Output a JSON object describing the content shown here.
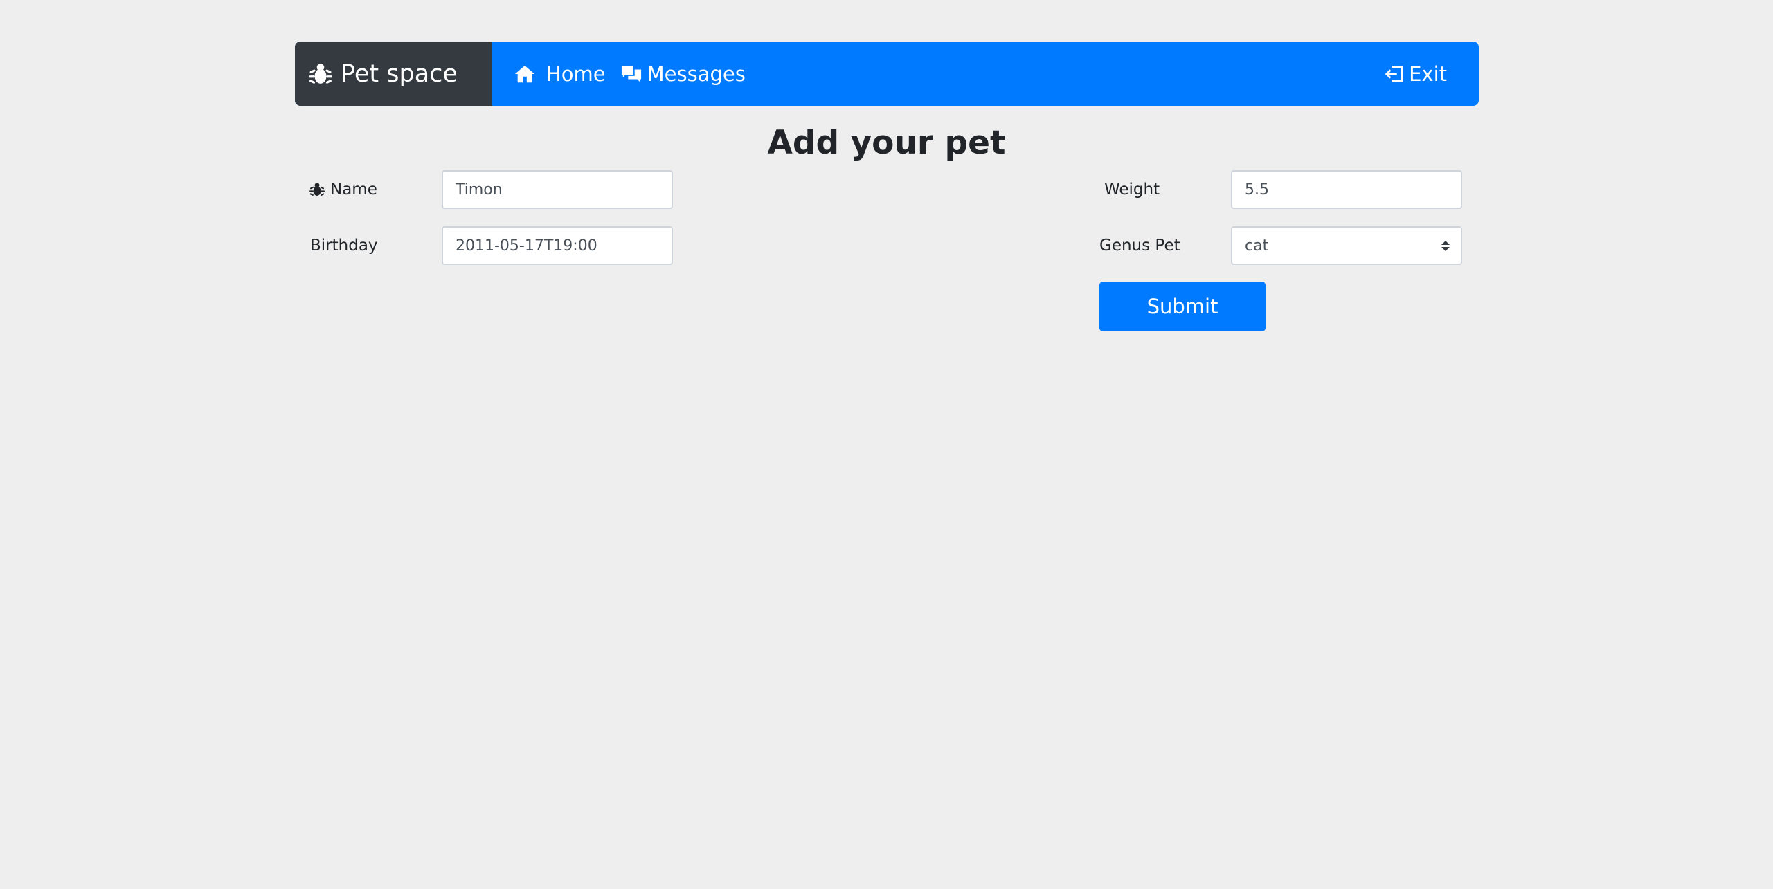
{
  "navbar": {
    "brand": "Pet space",
    "brand_icon": "paw-bug-icon",
    "links": [
      {
        "label": "Home",
        "icon": "home-icon"
      },
      {
        "label": "Messages",
        "icon": "messages-icon"
      }
    ],
    "exit_label": "Exit",
    "exit_icon": "exit-icon",
    "colors": {
      "primary": "#007bff",
      "brand_bg": "#343a40"
    }
  },
  "page": {
    "title": "Add your pet",
    "background": "#eeeeee"
  },
  "form": {
    "name": {
      "label": "Name",
      "value": "Timon"
    },
    "birthday": {
      "label": "Birthday",
      "value": "2011-05-17T19:00"
    },
    "weight": {
      "label": "Weight",
      "value": "5.5"
    },
    "genus": {
      "label": "Genus Pet",
      "selected": "cat"
    },
    "submit_label": "Submit"
  }
}
